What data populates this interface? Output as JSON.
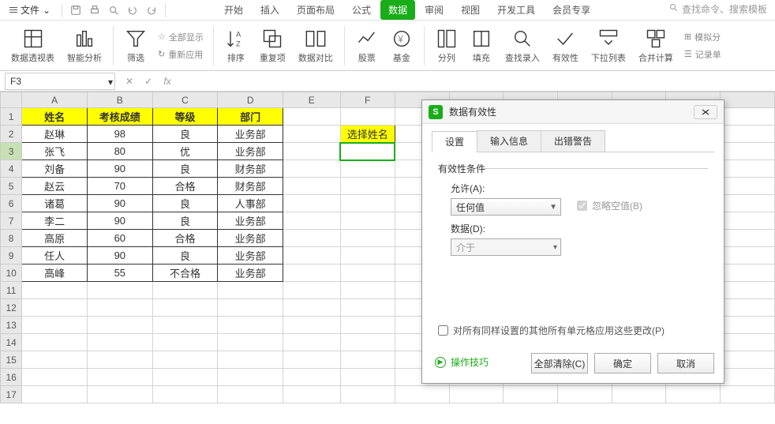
{
  "menu": {
    "file": "文件",
    "dropdown": "⌄"
  },
  "ribbon_tabs": [
    "开始",
    "插入",
    "页面布局",
    "公式",
    "数据",
    "审阅",
    "视图",
    "开发工具",
    "会员专享"
  ],
  "ribbon_active_tab": 4,
  "search_placeholder": "查找命令、搜索模板",
  "ribbon_buttons": {
    "pivot": "数据透视表",
    "smart": "智能分析",
    "filter": "筛选",
    "show_all": "全部显示",
    "reapply": "重新应用",
    "sort": "排序",
    "dedup": "重复项",
    "compare": "数据对比",
    "stock": "股票",
    "fund": "基金",
    "subtotal": "分列",
    "fill": "填充",
    "lookup": "查找录入",
    "validation": "有效性",
    "dropdown": "下拉列表",
    "consolidate": "合并计算",
    "record": "记录单",
    "simulate": "模拟分"
  },
  "name_box": "F3",
  "columns": [
    "A",
    "B",
    "C",
    "D",
    "E",
    "F"
  ],
  "headers": [
    "姓名",
    "考核成绩",
    "等级",
    "部门"
  ],
  "rows": [
    {
      "name": "赵琳",
      "score": "98",
      "grade": "良",
      "dept": "业务部"
    },
    {
      "name": "张飞",
      "score": "80",
      "grade": "优",
      "dept": "业务部"
    },
    {
      "name": "刘备",
      "score": "90",
      "grade": "良",
      "dept": "财务部"
    },
    {
      "name": "赵云",
      "score": "70",
      "grade": "合格",
      "dept": "财务部"
    },
    {
      "name": "诸葛",
      "score": "90",
      "grade": "良",
      "dept": "人事部"
    },
    {
      "name": "李二",
      "score": "90",
      "grade": "良",
      "dept": "业务部"
    },
    {
      "name": "高原",
      "score": "60",
      "grade": "合格",
      "dept": "业务部"
    },
    {
      "name": "任人",
      "score": "90",
      "grade": "良",
      "dept": "业务部"
    },
    {
      "name": "高峰",
      "score": "55",
      "grade": "不合格",
      "dept": "业务部"
    }
  ],
  "select_label": "选择姓名",
  "dialog": {
    "title": "数据有效性",
    "tabs": [
      "设置",
      "输入信息",
      "出错警告"
    ],
    "fieldset": "有效性条件",
    "allow_label": "允许(A):",
    "allow_value": "任何值",
    "ignore_blank": "忽略空值(B)",
    "data_label": "数据(D):",
    "data_value": "介于",
    "apply_same": "对所有同样设置的其他所有单元格应用这些更改(P)",
    "tips_link": "操作技巧",
    "clear_all": "全部清除(C)",
    "ok": "确定",
    "cancel": "取消"
  },
  "chart_data": {
    "type": "table",
    "title": "",
    "headers": [
      "姓名",
      "考核成绩",
      "等级",
      "部门"
    ],
    "rows": [
      [
        "赵琳",
        98,
        "良",
        "业务部"
      ],
      [
        "张飞",
        80,
        "优",
        "业务部"
      ],
      [
        "刘备",
        90,
        "良",
        "财务部"
      ],
      [
        "赵云",
        70,
        "合格",
        "财务部"
      ],
      [
        "诸葛",
        90,
        "良",
        "人事部"
      ],
      [
        "李二",
        90,
        "良",
        "业务部"
      ],
      [
        "高原",
        60,
        "合格",
        "业务部"
      ],
      [
        "任人",
        90,
        "良",
        "业务部"
      ],
      [
        "高峰",
        55,
        "不合格",
        "业务部"
      ]
    ]
  }
}
